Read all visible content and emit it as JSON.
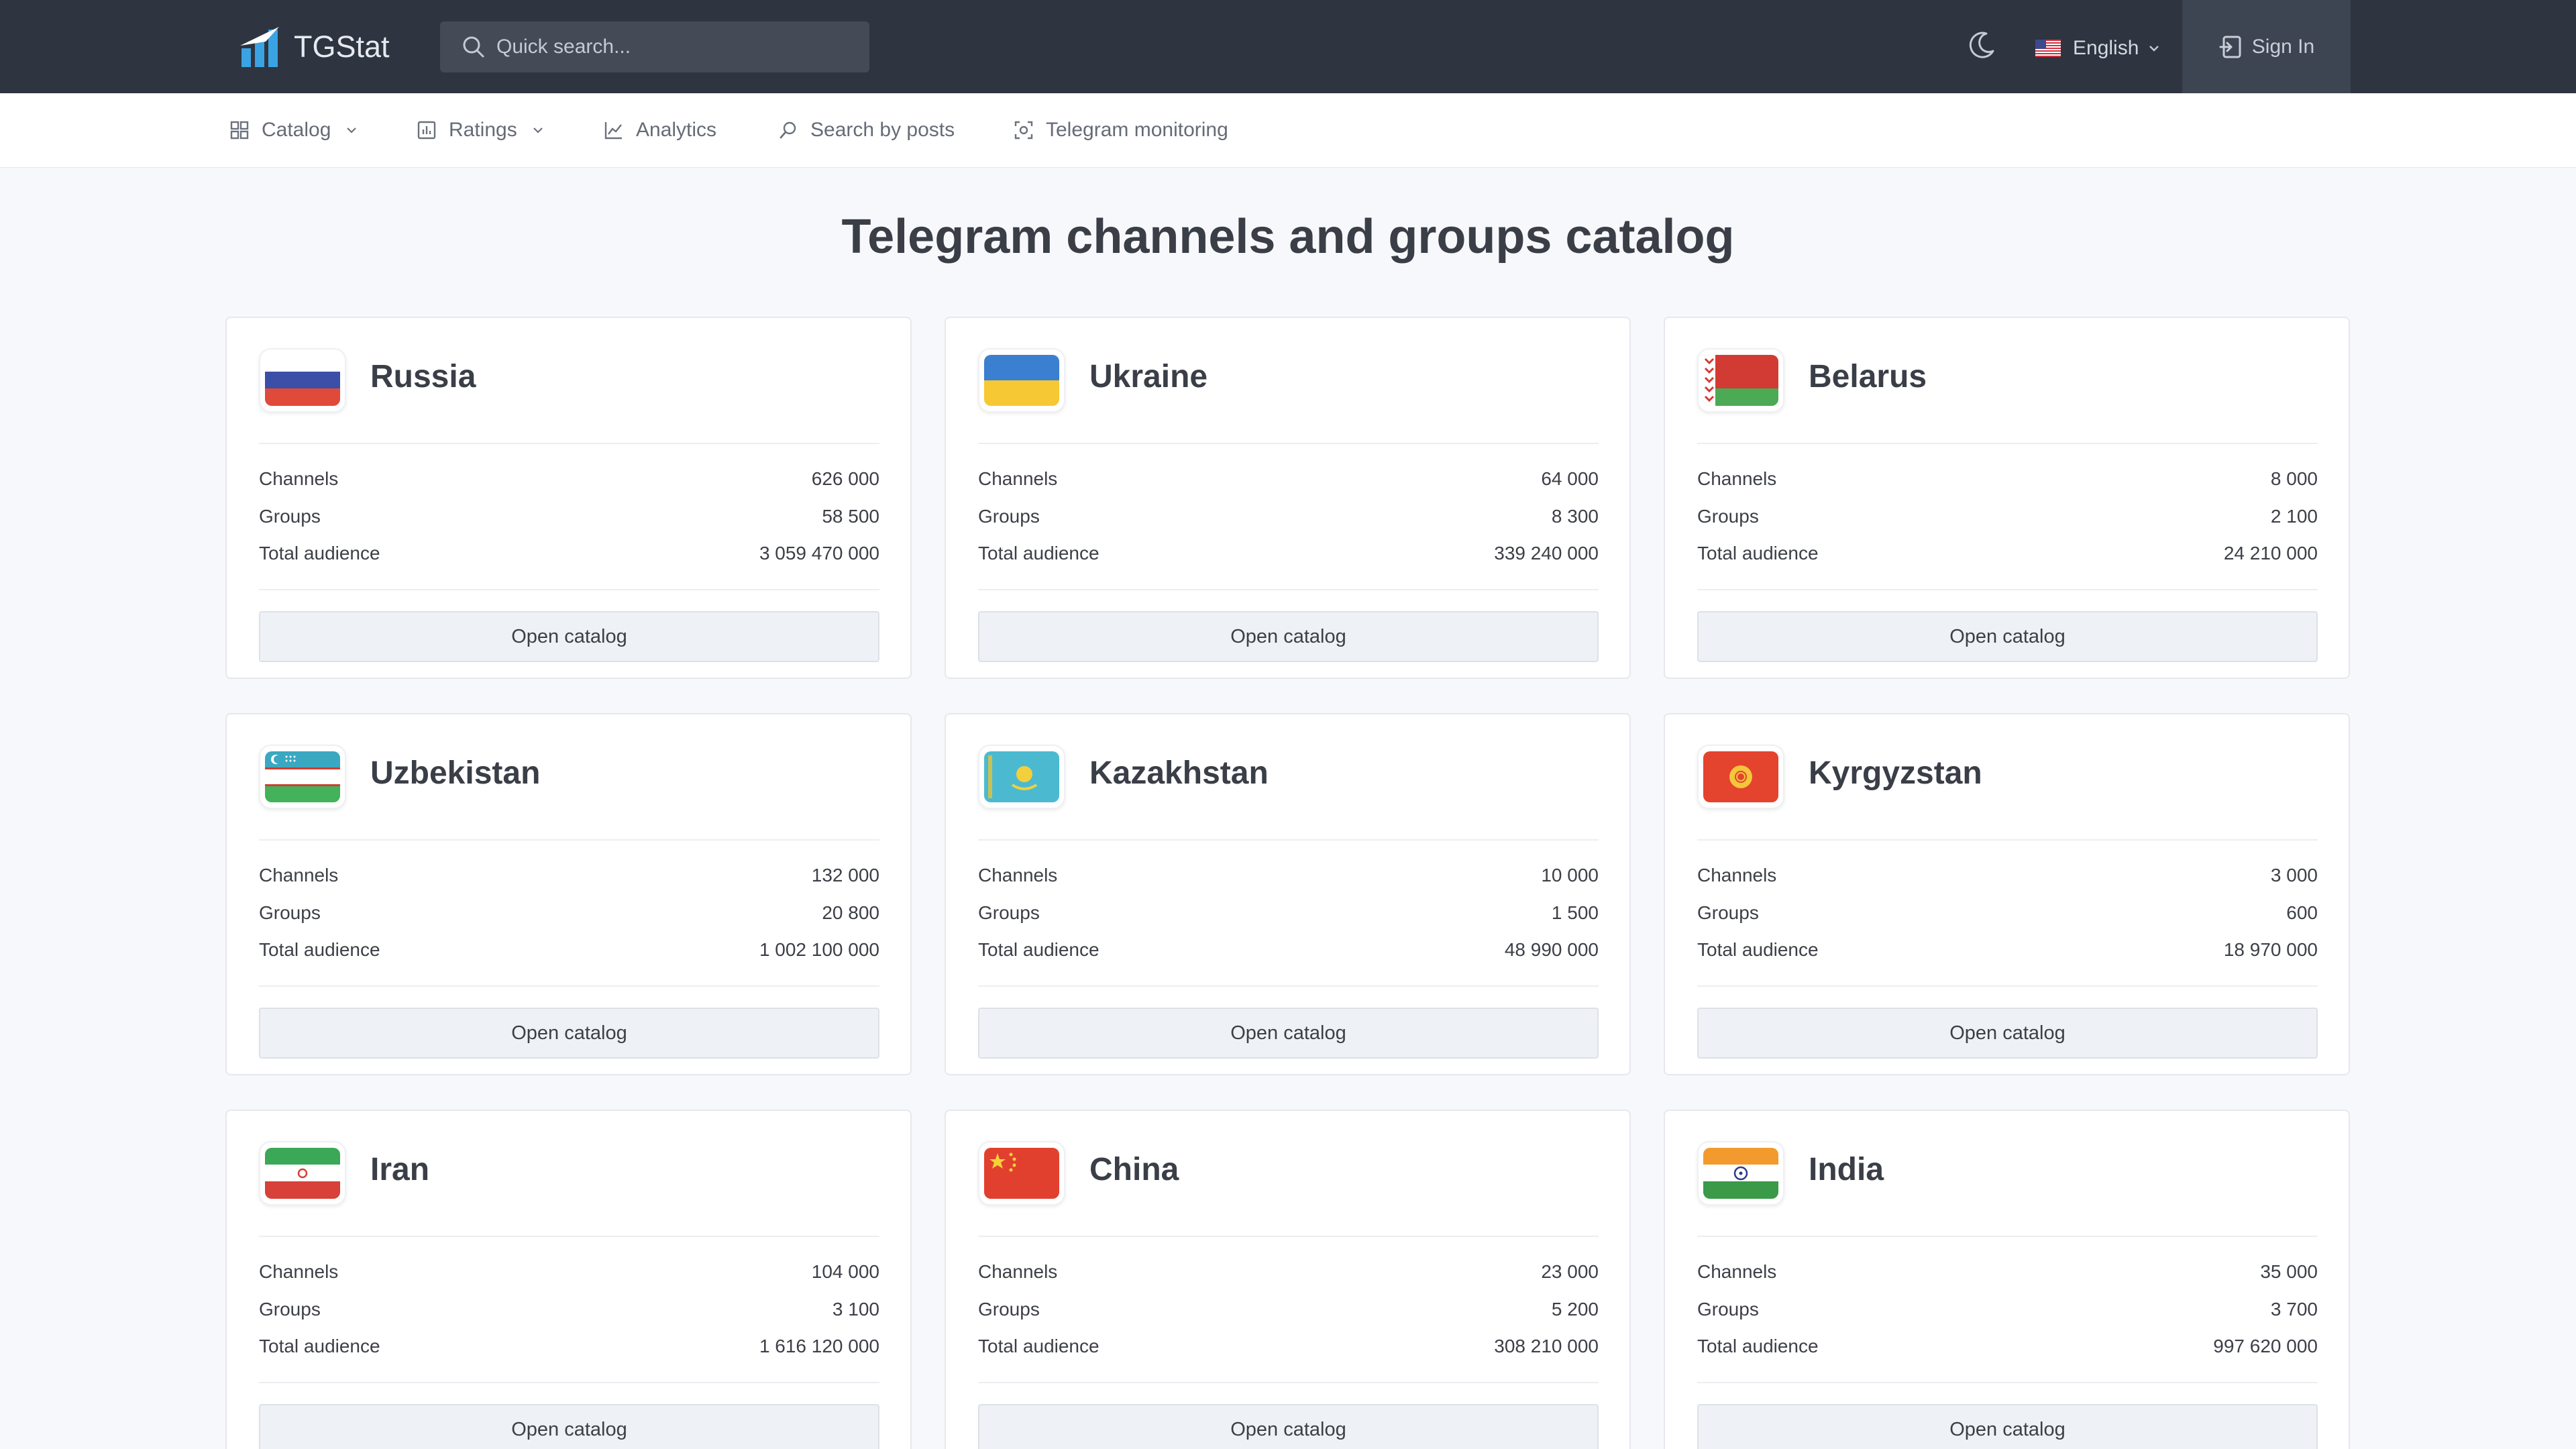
{
  "header": {
    "logo_text": "TGStat",
    "search_placeholder": "Quick search...",
    "language": "English",
    "signin": "Sign In"
  },
  "nav": {
    "catalog": "Catalog",
    "ratings": "Ratings",
    "analytics": "Analytics",
    "search_posts": "Search by posts",
    "monitoring": "Telegram monitoring"
  },
  "page": {
    "title": "Telegram channels and groups catalog"
  },
  "labels": {
    "channels": "Channels",
    "groups": "Groups",
    "audience": "Total audience",
    "open": "Open catalog"
  },
  "countries": [
    {
      "name": "Russia",
      "channels": "626 000",
      "groups": "58 500",
      "audience": "3 059 470 000"
    },
    {
      "name": "Ukraine",
      "channels": "64 000",
      "groups": "8 300",
      "audience": "339 240 000"
    },
    {
      "name": "Belarus",
      "channels": "8 000",
      "groups": "2 100",
      "audience": "24 210 000"
    },
    {
      "name": "Uzbekistan",
      "channels": "132 000",
      "groups": "20 800",
      "audience": "1 002 100 000"
    },
    {
      "name": "Kazakhstan",
      "channels": "10 000",
      "groups": "1 500",
      "audience": "48 990 000"
    },
    {
      "name": "Kyrgyzstan",
      "channels": "3 000",
      "groups": "600",
      "audience": "18 970 000"
    },
    {
      "name": "Iran",
      "channels": "104 000",
      "groups": "3 100",
      "audience": "1 616 120 000"
    },
    {
      "name": "China",
      "channels": "23 000",
      "groups": "5 200",
      "audience": "308 210 000"
    },
    {
      "name": "India",
      "channels": "35 000",
      "groups": "3 700",
      "audience": "997 620 000"
    }
  ]
}
